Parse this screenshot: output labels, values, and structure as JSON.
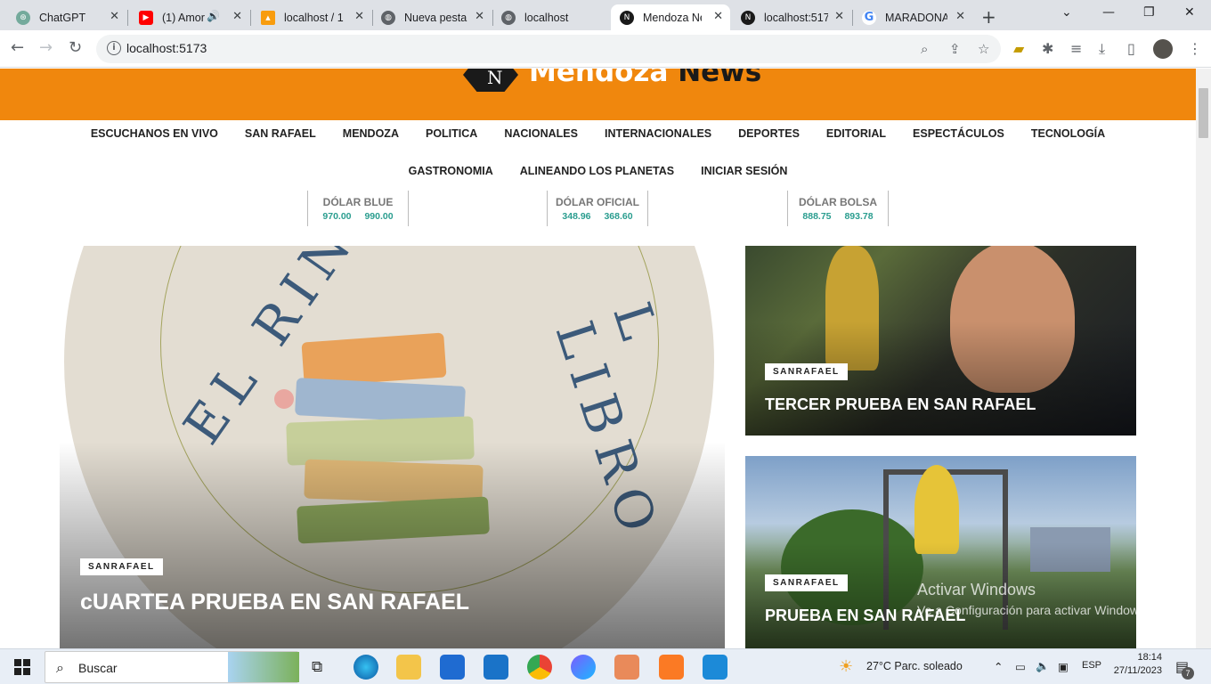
{
  "browser": {
    "tabs": [
      {
        "title": "ChatGPT",
        "icon": "chatgpt-icon"
      },
      {
        "title": "(1) Amor",
        "icon": "youtube-icon"
      },
      {
        "title": "localhost / 1",
        "icon": "phpmyadmin-icon"
      },
      {
        "title": "Nueva pesta",
        "icon": "globe-icon"
      },
      {
        "title": "localhost",
        "icon": "globe-icon"
      },
      {
        "title": "Mendoza Ne",
        "icon": "mendoza-news-icon"
      },
      {
        "title": "localhost:517",
        "icon": "mendoza-news-icon"
      },
      {
        "title": "MARADONA",
        "icon": "google-icon"
      }
    ],
    "url": "localhost:5173"
  },
  "site": {
    "logo_n": "N",
    "logo_word1": "Mendoza",
    "logo_word2": "News",
    "nav_row1": [
      "ESCUCHANOS EN VIVO",
      "SAN RAFAEL",
      "MENDOZA",
      "POLITICA",
      "NACIONALES",
      "INTERNACIONALES",
      "DEPORTES",
      "EDITORIAL",
      "ESPECTÁCULOS",
      "TECNOLOGÍA"
    ],
    "nav_row2": [
      "GASTRONOMIA",
      "ALINEANDO LOS PLANETAS",
      "INICIAR SESIÓN"
    ],
    "dolar": [
      {
        "label": "DÓLAR BLUE",
        "buy": "970.00",
        "sell": "990.00"
      },
      {
        "label": "DÓLAR OFICIAL",
        "buy": "348.96",
        "sell": "368.60"
      },
      {
        "label": "DÓLAR BOLSA",
        "buy": "888.75",
        "sell": "893.78"
      }
    ],
    "hero": {
      "image_text_left": "EL RINC",
      "image_text_right": "L LIBRO",
      "category": "SANRAFAEL",
      "title": "cUARTEA PRUEBA EN SAN RAFAEL"
    },
    "card1": {
      "category": "SANRAFAEL",
      "title": "TERCER PRUEBA EN SAN RAFAEL"
    },
    "card2": {
      "category": "SANRAFAEL",
      "title": "PRUEBA EN SAN RAFAEL"
    }
  },
  "watermark": {
    "line1": "Activar Windows",
    "line2": "Ve a Configuración para activar Windows."
  },
  "taskbar": {
    "search_label": "Buscar",
    "weather": "27°C  Parc. soleado",
    "lang": "ESP",
    "time": "18:14",
    "date": "27/11/2023",
    "notifications": "7"
  }
}
